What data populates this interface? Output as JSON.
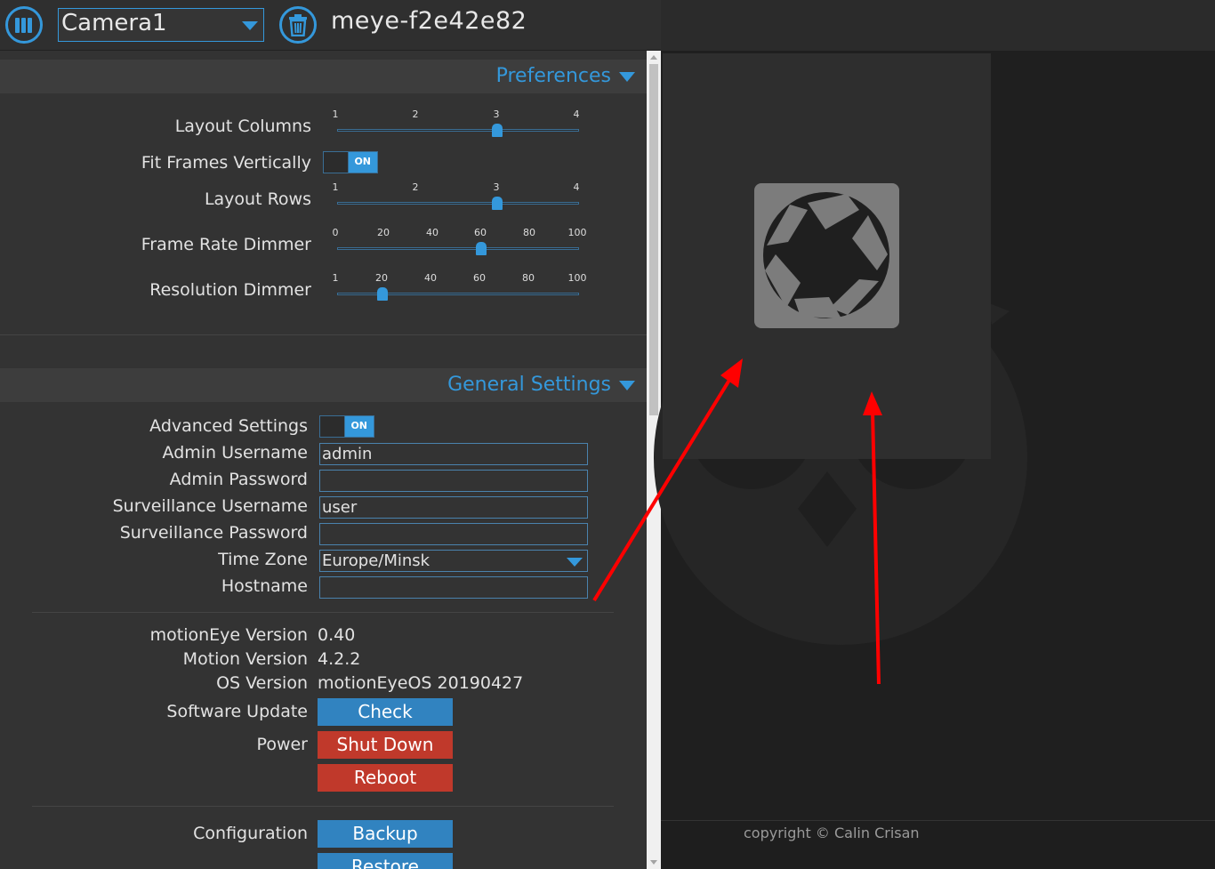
{
  "header": {
    "camera_select": "Camera1",
    "host_title": "meye-f2e42e82"
  },
  "preferences": {
    "title": "Preferences",
    "layout_columns": {
      "label": "Layout Columns",
      "ticks": [
        "1",
        "2",
        "3",
        "4"
      ],
      "value": 3
    },
    "fit_frames": {
      "label": "Fit Frames Vertically",
      "state": "ON"
    },
    "layout_rows": {
      "label": "Layout Rows",
      "ticks": [
        "1",
        "2",
        "3",
        "4"
      ],
      "value": 3
    },
    "frame_rate_dimmer": {
      "label": "Frame Rate Dimmer",
      "ticks": [
        "0",
        "20",
        "40",
        "60",
        "80",
        "100"
      ],
      "value": 60
    },
    "resolution_dimmer": {
      "label": "Resolution Dimmer",
      "ticks": [
        "1",
        "20",
        "40",
        "60",
        "80",
        "100"
      ],
      "value": 20
    }
  },
  "general": {
    "title": "General Settings",
    "advanced": {
      "label": "Advanced Settings",
      "state": "ON"
    },
    "admin_username": {
      "label": "Admin Username",
      "value": "admin"
    },
    "admin_password": {
      "label": "Admin Password",
      "value": ""
    },
    "surv_username": {
      "label": "Surveillance Username",
      "value": "user"
    },
    "surv_password": {
      "label": "Surveillance Password",
      "value": ""
    },
    "time_zone": {
      "label": "Time Zone",
      "value": "Europe/Minsk"
    },
    "hostname": {
      "label": "Hostname",
      "value": ""
    },
    "motioneye_version": {
      "label": "motionEye Version",
      "value": "0.40"
    },
    "motion_version": {
      "label": "Motion Version",
      "value": "4.2.2"
    },
    "os_version": {
      "label": "OS Version",
      "value": "motionEyeOS 20190427"
    },
    "software_update": {
      "label": "Software Update",
      "button": "Check"
    },
    "power": {
      "label": "Power",
      "shutdown": "Shut Down",
      "reboot": "Reboot"
    },
    "configuration": {
      "label": "Configuration",
      "backup": "Backup",
      "restore": "Restore"
    }
  },
  "footer": {
    "copyright": "copyright © Calin Crisan"
  },
  "colors": {
    "accent": "#3498db",
    "danger": "#c0392b",
    "annotation": "#ff0000"
  },
  "icons": [
    "menu-icon",
    "trash-icon",
    "camera-aperture-icon",
    "owl-logo-icon"
  ]
}
